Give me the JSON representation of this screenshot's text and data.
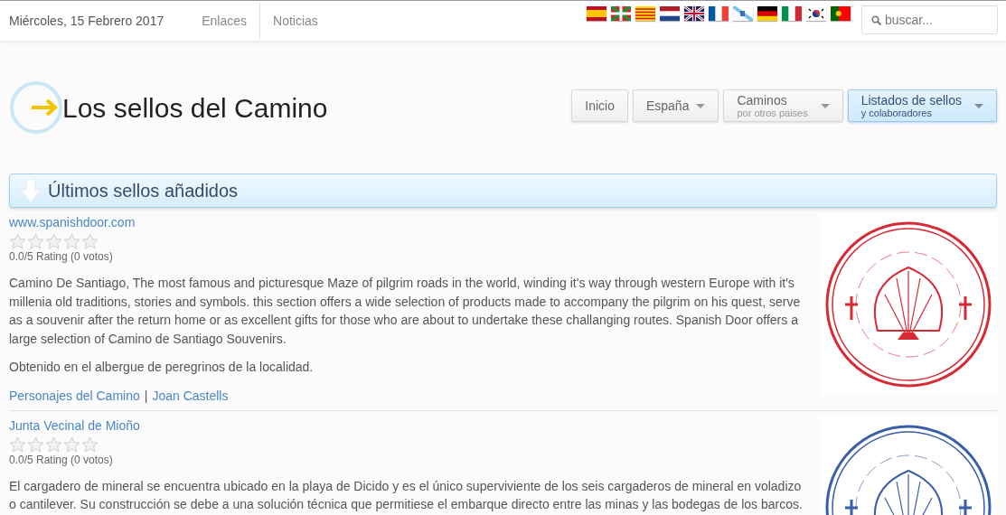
{
  "top_bar": {
    "date": "Miércoles, 15 Febrero 2017",
    "links": [
      "Enlaces",
      "Noticias"
    ],
    "search": {
      "placeholder": "buscar..."
    }
  },
  "site_title": "Los sellos del Camino",
  "nav": [
    {
      "label": "Inicio",
      "selected": false
    },
    {
      "label": "España",
      "dropdown": true,
      "selected": false
    },
    {
      "label": "Caminos",
      "subtitle": "por otros paises",
      "dropdown": true,
      "selected": false
    },
    {
      "label": "Listados de sellos",
      "subtitle": "y colaboradores",
      "dropdown": true,
      "selected": true
    }
  ],
  "section_title": "Últimos sellos añadidos",
  "entries": [
    {
      "title": "www.spanishdoor.com",
      "stars": 0,
      "rating": "0.0/5 Rating (0 votos)",
      "paragraphs": [
        "Camino De Santiago, The most famous and picturesque Maze of pilgrim roads in the world, winding it's way through western Europe with it's millenia old traditions, stories and symbols. this section offers a wide selection of products made to accompany the pilgrim on his quest, serve as a souvenir after the return home or as excellent gifts for those who are about to undertake these challanging routes. Spanish Door offers a large selection of Camino de Santiago Souvenirs.",
        "Obtenido en el albergue de peregrinos de la localidad."
      ],
      "tags": [
        "Personajes del Camino",
        "Joan Castells"
      ],
      "tag_separator": "|",
      "image": {
        "kind": "picture"
      }
    },
    {
      "title": "Junta Vecinal de Mioño",
      "stars": 0,
      "rating": "0.0/5 Rating (0 votos)",
      "paragraphs": [
        "El cargadero de mineral se encuentra ubicado en la playa de Dicido y es el único superviviente de los seis cargaderos de mineral en voladizo o cantilever. Su construcción se debe a una solución técnica que permitiese el embarque directo entre las minas y las bodegas de los barcos."
      ],
      "image": {
        "kind": "picture"
      }
    }
  ]
}
